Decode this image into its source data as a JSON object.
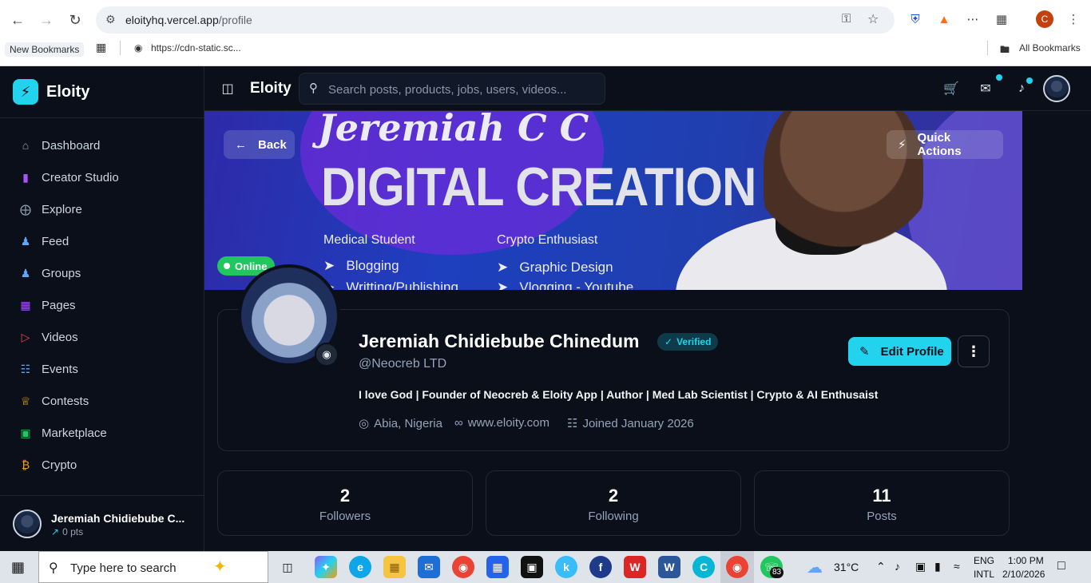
{
  "browser": {
    "url_host": "eloityhq.vercel.app",
    "url_path": "/profile",
    "bookmarks": [
      {
        "label": "New Bookmarks"
      },
      {
        "label": "https://cdn-static.sc..."
      }
    ],
    "all_bookmarks_label": "All Bookmarks",
    "profile_initial": "C"
  },
  "app": {
    "brand_name": "Eloity",
    "topbar_title": "Eloity",
    "search_placeholder": "Search posts, products, jobs, users, videos...",
    "accent": "#22d3ee"
  },
  "sidebar": {
    "items": [
      {
        "label": "Dashboard",
        "icon": "home-icon",
        "color": "#94a3b8"
      },
      {
        "label": "Creator Studio",
        "icon": "bar-chart-icon",
        "color": "#a855f7"
      },
      {
        "label": "Explore",
        "icon": "compass-icon",
        "color": "#94a3b8"
      },
      {
        "label": "Feed",
        "icon": "users-icon",
        "color": "#60a5fa"
      },
      {
        "label": "Groups",
        "icon": "group-icon",
        "color": "#60a5fa"
      },
      {
        "label": "Pages",
        "icon": "grid-icon",
        "color": "#a855f7"
      },
      {
        "label": "Videos",
        "icon": "video-icon",
        "color": "#ef4444"
      },
      {
        "label": "Events",
        "icon": "calendar-icon",
        "color": "#60a5fa"
      },
      {
        "label": "Contests",
        "icon": "trophy-icon",
        "color": "#eab308"
      },
      {
        "label": "Marketplace",
        "icon": "shopping-bag-icon",
        "color": "#22c55e"
      },
      {
        "label": "Crypto",
        "icon": "bitcoin-icon",
        "color": "#f59e0b"
      }
    ],
    "user": {
      "name": "Jeremiah Chidiebube C...",
      "points": "0 pts"
    }
  },
  "banner": {
    "script_name": "Jeremiah C C",
    "headline": "DIGITAL CREATION",
    "left_title": "Medical Student",
    "left_items": [
      "Blogging",
      "Writting/Publishing"
    ],
    "right_title": "Crypto Enthusiast",
    "right_items": [
      "Graphic Design",
      "Vlogging - Youtube"
    ],
    "back_label": "Back",
    "quick_actions_label": "Quick Actions",
    "online_label": "Online"
  },
  "profile": {
    "name": "Jeremiah Chidiebube Chinedum",
    "verified_label": "Verified",
    "handle": "@Neocreb LTD",
    "bio": "I love God | Founder of Neocreb & Eloity App | Author | Med Lab Scientist | Crypto & AI Enthusaist",
    "location": "Abia, Nigeria",
    "website": "www.eloity.com",
    "joined": "Joined January 2026",
    "edit_label": "Edit Profile"
  },
  "stats": [
    {
      "value": "2",
      "label": "Followers"
    },
    {
      "value": "2",
      "label": "Following"
    },
    {
      "value": "11",
      "label": "Posts"
    }
  ],
  "taskbar": {
    "search_placeholder": "Type here to search",
    "weather": "31°C",
    "lang_1": "ENG",
    "lang_2": "INTL",
    "time": "1:00 PM",
    "date": "2/10/2026",
    "whatsapp_badge": "83"
  }
}
